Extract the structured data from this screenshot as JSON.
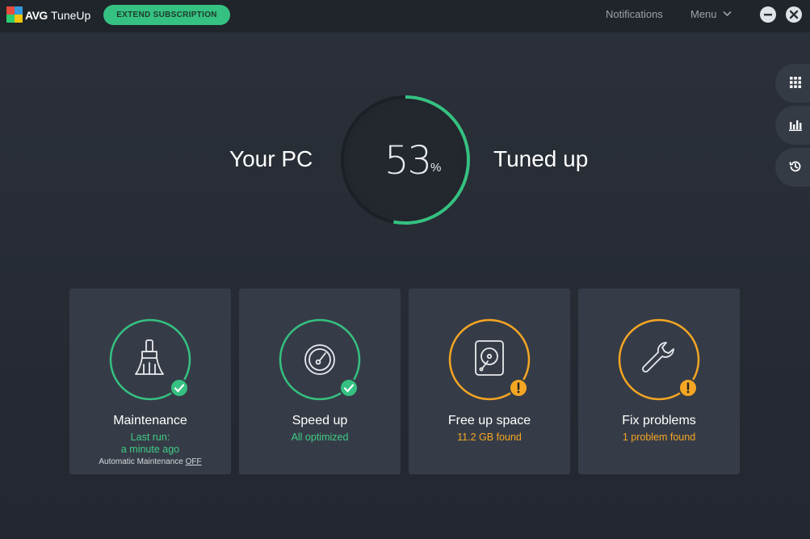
{
  "app": {
    "brand_avg": "AVG",
    "brand_name": "TuneUp",
    "extend_label": "EXTEND SUBSCRIPTION",
    "notifications_label": "Notifications",
    "menu_label": "Menu"
  },
  "hero": {
    "left_label": "Your PC",
    "right_label": "Tuned up",
    "value": "53",
    "unit": "%",
    "progress": 0.53
  },
  "cards": [
    {
      "title": "Maintenance",
      "status_line1": "Last run:",
      "status_line2": "a minute ago",
      "auto_prefix": "Automatic Maintenance",
      "auto_state": "OFF",
      "icon": "broom-icon",
      "status": "ok"
    },
    {
      "title": "Speed up",
      "status_line1": "All optimized",
      "icon": "speedometer-icon",
      "status": "ok"
    },
    {
      "title": "Free up space",
      "status_line1": "11.2 GB found",
      "icon": "hard-drive-icon",
      "status": "warning"
    },
    {
      "title": "Fix problems",
      "status_line1": "1 problem found",
      "icon": "wrench-icon",
      "status": "warning"
    }
  ],
  "side_panel": [
    "apps-grid-icon",
    "bar-chart-icon",
    "history-icon"
  ],
  "colors": {
    "accent_green": "#35c181",
    "warning_orange": "#f5a623",
    "card_bg": "#363c47",
    "titlebar_bg": "#20242b"
  }
}
